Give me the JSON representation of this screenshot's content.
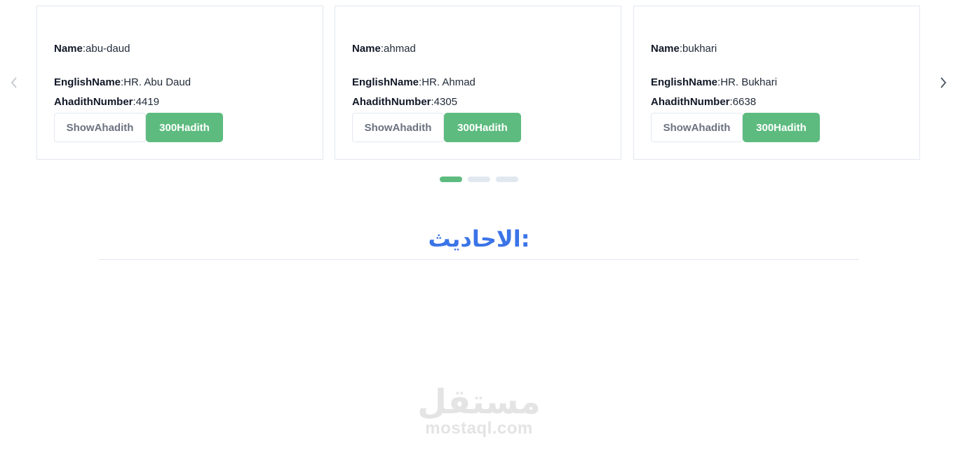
{
  "carousel": {
    "prev_icon": "chevron-left-icon",
    "next_icon": "chevron-right-icon",
    "cards": [
      {
        "name_key": "Name",
        "name_value": ":abu-daud",
        "english_key": "EnglishName",
        "english_value": ":HR. Abu Daud",
        "number_key": "AhadithNumber",
        "number_value": ":4419",
        "show_label": "ShowAhadith",
        "hadith_label": "300Hadith"
      },
      {
        "name_key": "Name",
        "name_value": ":ahmad",
        "english_key": "EnglishName",
        "english_value": ":HR. Ahmad",
        "number_key": "AhadithNumber",
        "number_value": ":4305",
        "show_label": "ShowAhadith",
        "hadith_label": "300Hadith"
      },
      {
        "name_key": "Name",
        "name_value": ":bukhari",
        "english_key": "EnglishName",
        "english_value": ":HR. Bukhari",
        "number_key": "AhadithNumber",
        "number_value": ":6638",
        "show_label": "ShowAhadith",
        "hadith_label": "300Hadith"
      }
    ],
    "dots": {
      "count": 3,
      "active_index": 0
    }
  },
  "section": {
    "title": ":الاحاديث"
  },
  "watermark": {
    "arabic": "مستقل",
    "latin": "mostaql.com"
  },
  "colors": {
    "accent_green": "#5dbb7f",
    "title_blue": "#3b74e8",
    "border_gray": "#e2e8f0"
  }
}
